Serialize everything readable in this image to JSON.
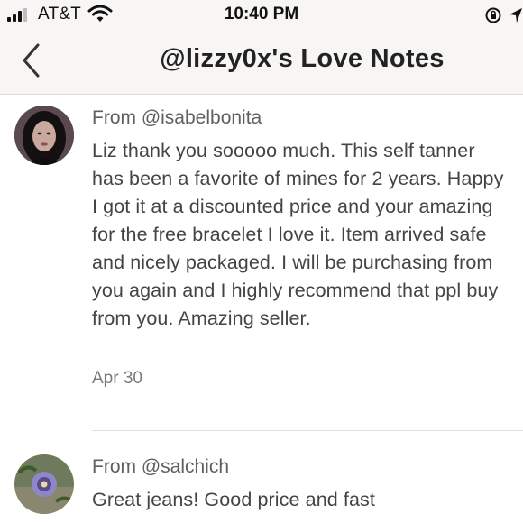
{
  "status_bar": {
    "carrier": "AT&T",
    "time": "10:40 PM"
  },
  "header": {
    "title": "@lizzy0x's Love Notes"
  },
  "notes": [
    {
      "from": "From @isabelbonita",
      "text": "Liz thank you sooooo much. This self tanner has been a favorite of mines for 2 years. Happy I got it at a discounted price and your amazing for the free bracelet I love it. Item arrived safe and nicely packaged. I will be purchasing from you again and I highly recommend that ppl buy from you. Amazing seller.",
      "date": "Apr 30"
    },
    {
      "from": "From @salchich",
      "text": "Great jeans! Good price and fast"
    }
  ]
}
